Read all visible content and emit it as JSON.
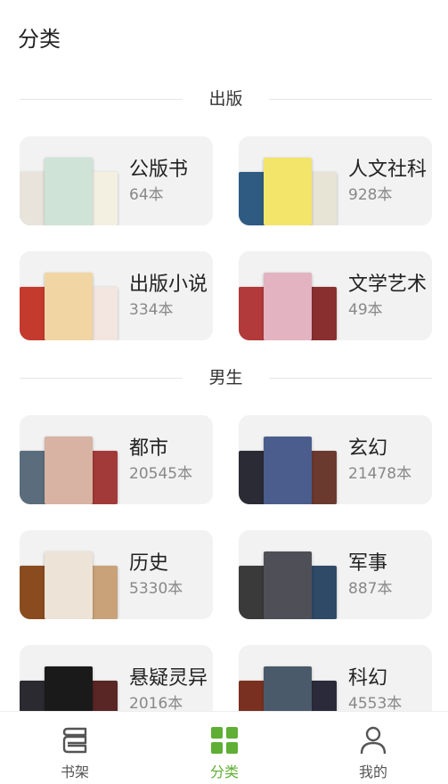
{
  "header": {
    "title": "分类"
  },
  "sections": [
    {
      "title": "出版",
      "items": [
        {
          "name": "公版书",
          "count": "64本",
          "colors": [
            "#e8e4dc",
            "#cfe3d6",
            "#f3f0e2"
          ]
        },
        {
          "name": "人文社科",
          "count": "928本",
          "colors": [
            "#2f5b83",
            "#f3e46a",
            "#e7e4d6"
          ]
        },
        {
          "name": "出版小说",
          "count": "334本",
          "colors": [
            "#c43b2e",
            "#f1d6a3",
            "#f3e6e1"
          ]
        },
        {
          "name": "文学艺术",
          "count": "49本",
          "colors": [
            "#b23a3a",
            "#e3b3c2",
            "#8a2f2f"
          ]
        }
      ]
    },
    {
      "title": "男生",
      "items": [
        {
          "name": "都市",
          "count": "20545本",
          "colors": [
            "#5b6d7d",
            "#d8b2a3",
            "#a33a3a"
          ]
        },
        {
          "name": "玄幻",
          "count": "21478本",
          "colors": [
            "#2b2b35",
            "#4a5d8c",
            "#6a3a2e"
          ]
        },
        {
          "name": "历史",
          "count": "5330本",
          "colors": [
            "#8a4c1f",
            "#ede3d6",
            "#c9a27a"
          ]
        },
        {
          "name": "军事",
          "count": "887本",
          "colors": [
            "#3a3a3a",
            "#4f4f58",
            "#2e4a66"
          ]
        },
        {
          "name": "悬疑灵异",
          "count": "2016本",
          "colors": [
            "#2a2a30",
            "#1a1a1a",
            "#5a2525"
          ]
        },
        {
          "name": "科幻",
          "count": "4553本",
          "colors": [
            "#7a3020",
            "#4a5a6a",
            "#2a2a3a"
          ]
        }
      ]
    }
  ],
  "tabbar": {
    "items": [
      {
        "label": "书架",
        "active": false
      },
      {
        "label": "分类",
        "active": true
      },
      {
        "label": "我的",
        "active": false
      }
    ],
    "active_color": "#5eaf34",
    "inactive_color": "#555555"
  }
}
